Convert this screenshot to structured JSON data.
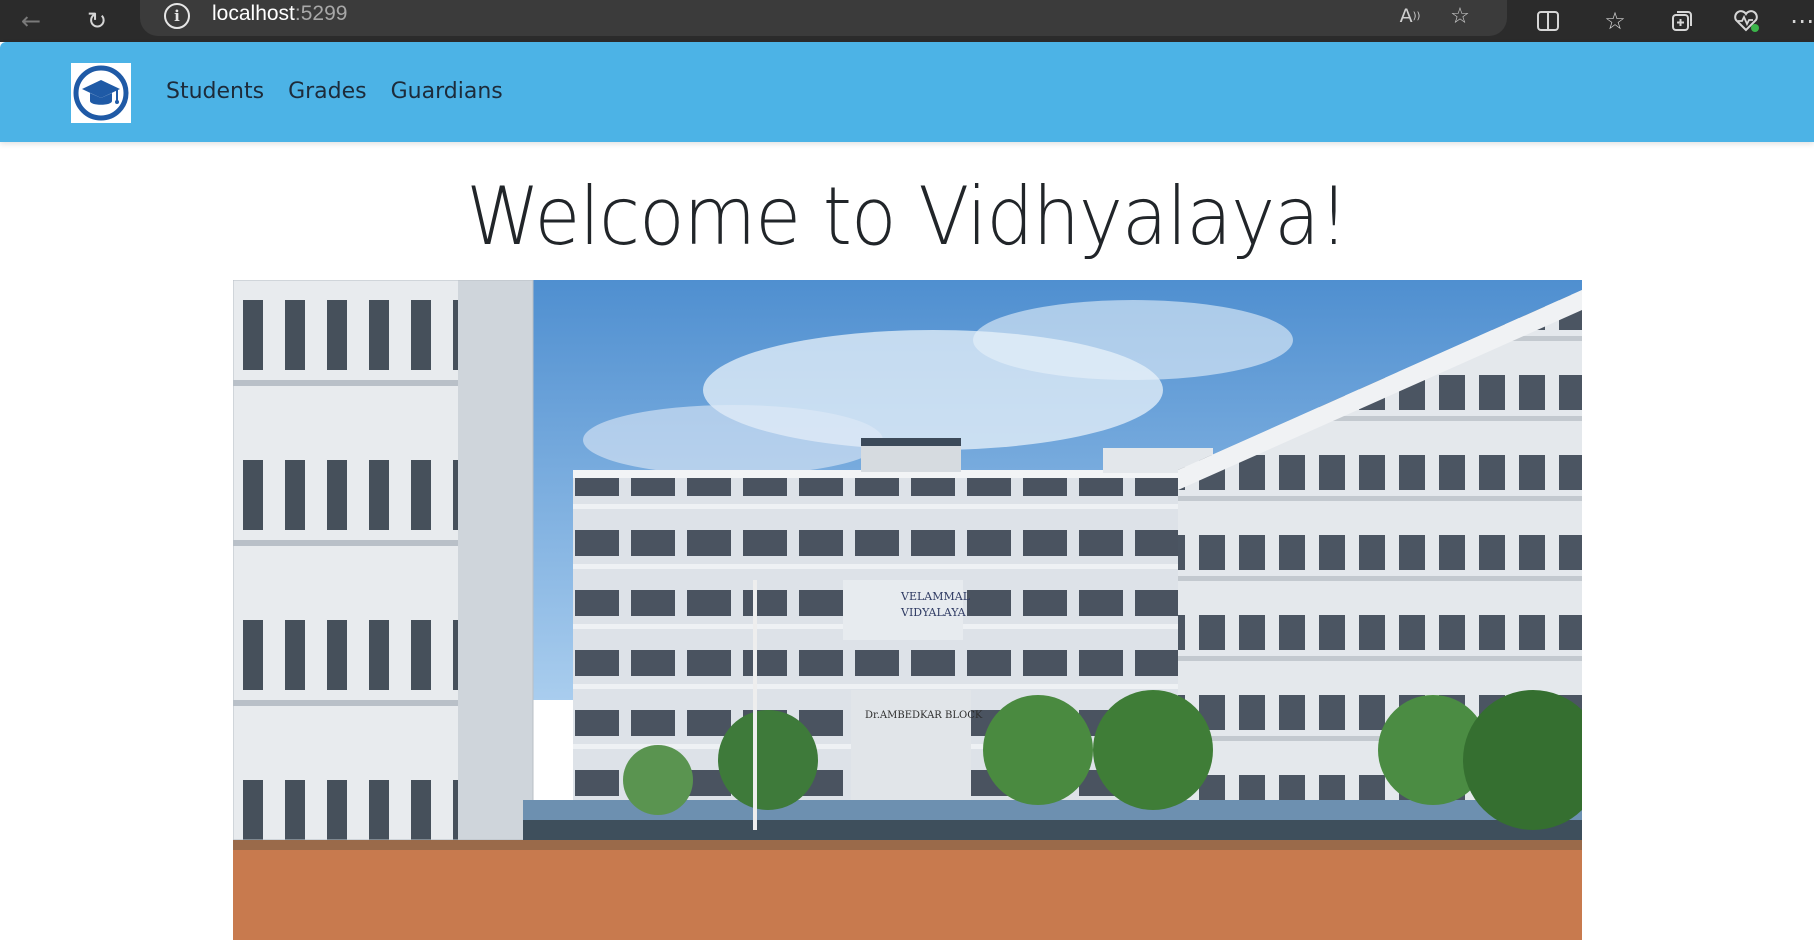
{
  "browser": {
    "url_host": "localhost",
    "url_port": ":5299",
    "icons": [
      "back-icon",
      "refresh-icon",
      "site-info-icon",
      "read-aloud-icon",
      "favorite-star-icon",
      "split-screen-icon",
      "favorites-icon",
      "collections-icon",
      "browser-essentials-icon",
      "more-icon"
    ]
  },
  "navbar": {
    "logo_icon": "graduation-cap-icon",
    "links": [
      {
        "label": "Students"
      },
      {
        "label": "Grades"
      },
      {
        "label": "Guardians"
      }
    ]
  },
  "hero": {
    "title": "Welcome to Vidhyalaya!",
    "photo_signs": {
      "school_name_line1": "VELAMMAL",
      "school_name_line2": "VIDYALAYA",
      "block_sign": "Dr.AMBEDKAR BLOCK"
    }
  },
  "colors": {
    "navbar": "#4cb3e6",
    "browser_chrome": "#2b2b2b",
    "logo_ring": "#1f5aa6"
  }
}
